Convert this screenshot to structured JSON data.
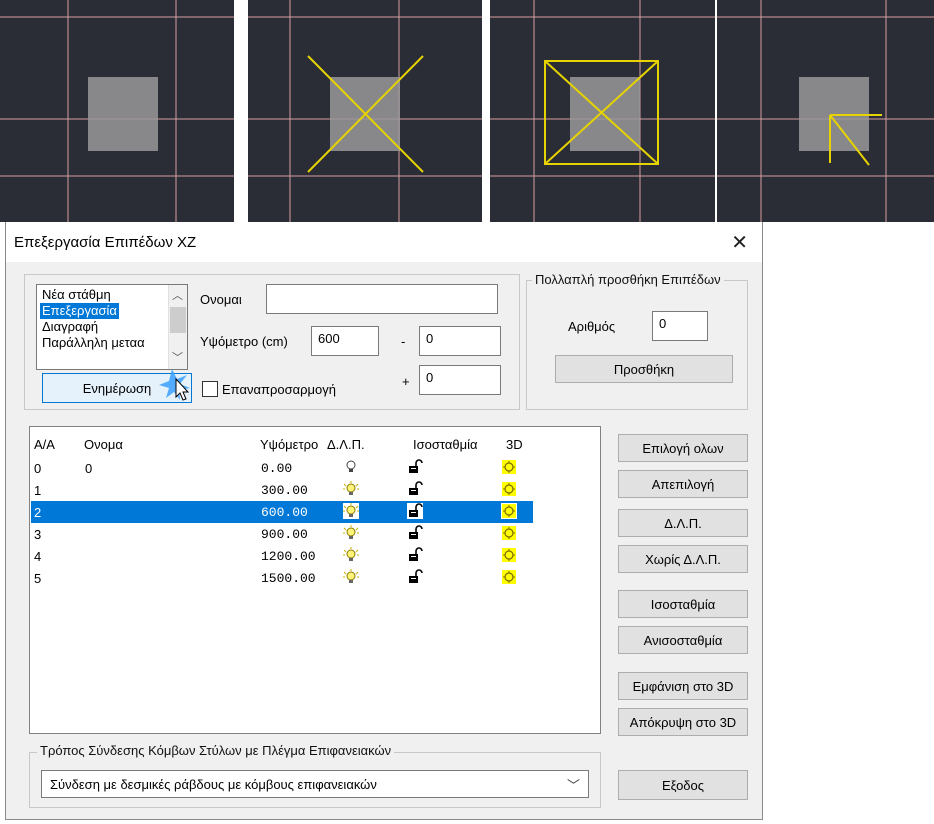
{
  "cad_previews": [
    {
      "name": "plain",
      "pattern": "none"
    },
    {
      "name": "x-diagonals",
      "pattern": "x"
    },
    {
      "name": "x-with-frame",
      "pattern": "x-frame"
    },
    {
      "name": "corner-links",
      "pattern": "corner"
    }
  ],
  "colors": {
    "cad_bg": "#2a2d36",
    "grid": "#d6a0a0",
    "square": "#999999",
    "link": "#e6d300",
    "accent": "#0078d7"
  },
  "dialog": {
    "title": "Επεξεργασία Επιπέδων XZ",
    "close_glyph": "✕",
    "mode_list": [
      "Νέα στάθμη",
      "Επεξεργασία",
      "Διαγραφή",
      "Παράλληλη μεταφορά"
    ],
    "mode_list_visible": [
      "Νέα στάθμη",
      "Επεξεργασία",
      "Διαγραφή",
      "Παράλληλη μεταα"
    ],
    "mode_selected_index": 1,
    "name_label": "Ονομα",
    "name_label_visible": "Ονομαι",
    "name_value": "",
    "elevation_label": "Υψόμετρο (cm)",
    "elevation_value": "600",
    "minus_sign": "-",
    "plus_sign": "+",
    "minus_value": "0",
    "plus_value": "0",
    "update_button": "Ενημέρωση",
    "readjust_label": "Επαναπροσαρμογή",
    "readjust_checked": false,
    "multi_group": {
      "title": "Πολλαπλή προσθήκη Επιπέδων",
      "count_label": "Αριθμός",
      "count_value": "0",
      "add_button": "Προσθήκη"
    },
    "table": {
      "headers": [
        "Α/Α",
        "Ονομα",
        "Υψόμετρο",
        "Δ.Λ.Π.",
        "Ισοσταθμία",
        "3D"
      ],
      "rows": [
        {
          "aa": "0",
          "name": "0",
          "elev": "0.00",
          "dlp": "bulb-off",
          "iso": "unlock",
          "d3": "on"
        },
        {
          "aa": "1",
          "name": "",
          "elev": "300.00",
          "dlp": "bulb-on",
          "iso": "unlock",
          "d3": "on"
        },
        {
          "aa": "2",
          "name": "",
          "elev": "600.00",
          "dlp": "bulb-on",
          "iso": "unlock",
          "d3": "on"
        },
        {
          "aa": "3",
          "name": "",
          "elev": "900.00",
          "dlp": "bulb-on",
          "iso": "unlock",
          "d3": "on"
        },
        {
          "aa": "4",
          "name": "",
          "elev": "1200.00",
          "dlp": "bulb-on",
          "iso": "unlock",
          "d3": "on"
        },
        {
          "aa": "5",
          "name": "",
          "elev": "1500.00",
          "dlp": "bulb-on",
          "iso": "unlock",
          "d3": "on"
        }
      ],
      "selected_row": 2
    },
    "side_buttons": [
      "Επιλογή ολων",
      "Απεπιλογή",
      "Δ.Λ.Π.",
      "Χωρίς Δ.Λ.Π.",
      "Ισοσταθμία",
      "Ανισοσταθμία",
      "Εμφάνιση στο 3D",
      "Απόκρυψη στο 3D"
    ],
    "connection_group": {
      "title": "Τρόπος Σύνδεσης Κόμβων Στύλων με Πλέγμα Επιφανειακών",
      "selected": "Σύνδεση με δεσμικές ράβδους με κόμβους επιφανειακών"
    },
    "exit_button": "Εξοδος"
  }
}
